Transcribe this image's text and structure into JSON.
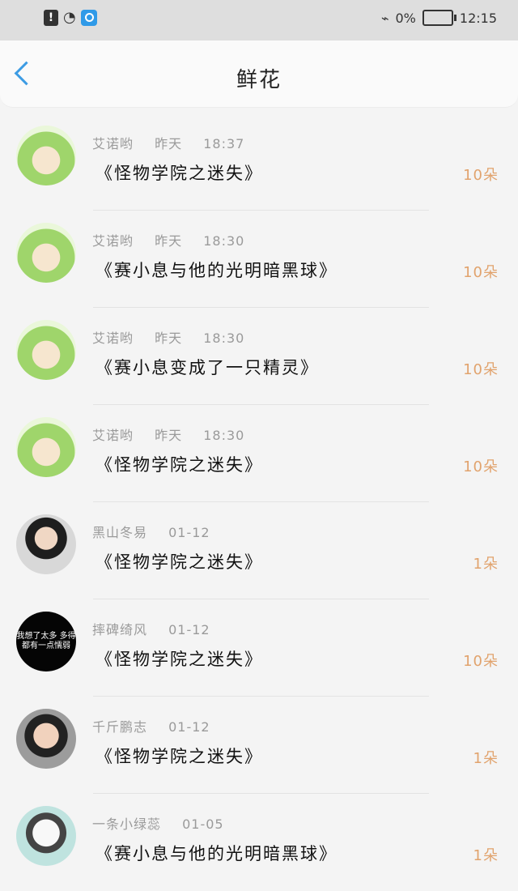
{
  "statusbar": {
    "battery_percent": "0%",
    "time": "12:15",
    "icons": [
      "sim-alert-icon",
      "wifi-icon",
      "search-app-icon",
      "vibrate-icon",
      "battery-icon"
    ]
  },
  "nav": {
    "title": "鲜花",
    "back_icon": "back-arrow-icon"
  },
  "items": [
    {
      "user": "艾诺哟",
      "date": "昨天",
      "time": "18:37",
      "work": "《怪物学院之迷失》",
      "count": "10朵",
      "avatar": "green"
    },
    {
      "user": "艾诺哟",
      "date": "昨天",
      "time": "18:30",
      "work": "《赛小息与他的光明暗黑球》",
      "count": "10朵",
      "avatar": "green"
    },
    {
      "user": "艾诺哟",
      "date": "昨天",
      "time": "18:30",
      "work": "《赛小息变成了一只精灵》",
      "count": "10朵",
      "avatar": "green"
    },
    {
      "user": "艾诺哟",
      "date": "昨天",
      "time": "18:30",
      "work": "《怪物学院之迷失》",
      "count": "10朵",
      "avatar": "green"
    },
    {
      "user": "黑山冬易",
      "date": "01-12",
      "time": "",
      "work": "《怪物学院之迷失》",
      "count": "1朵",
      "avatar": "girl"
    },
    {
      "user": "摔碑绮风",
      "date": "01-12",
      "time": "",
      "work": "《怪物学院之迷失》",
      "count": "10朵",
      "avatar": "black",
      "avatar_text": "我想了太多\n多得都有一点懦弱"
    },
    {
      "user": "千斤鹏志",
      "date": "01-12",
      "time": "",
      "work": "《怪物学院之迷失》",
      "count": "1朵",
      "avatar": "child"
    },
    {
      "user": "一条小绿蕊",
      "date": "01-05",
      "time": "",
      "work": "《赛小息与他的光明暗黑球》",
      "count": "1朵",
      "avatar": "sketch"
    }
  ]
}
